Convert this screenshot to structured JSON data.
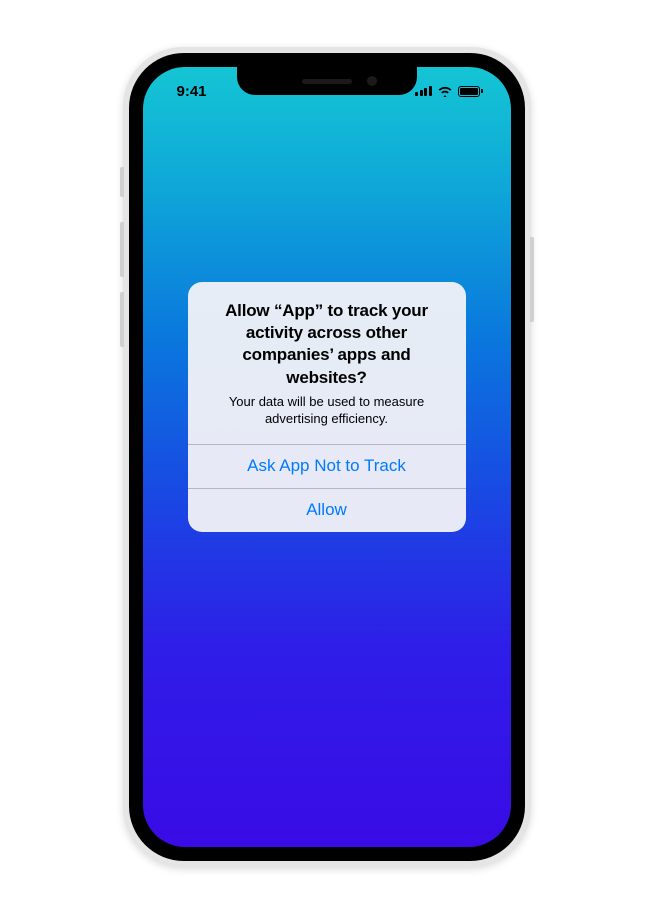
{
  "status_bar": {
    "time": "9:41"
  },
  "alert": {
    "title": "Allow “App” to track your activity across other companies’ apps and websites?",
    "message": "Your data will be used to measure advertising efficiency.",
    "deny_label": "Ask App Not to Track",
    "allow_label": "Allow"
  },
  "colors": {
    "ios_blue": "#007AFF"
  }
}
